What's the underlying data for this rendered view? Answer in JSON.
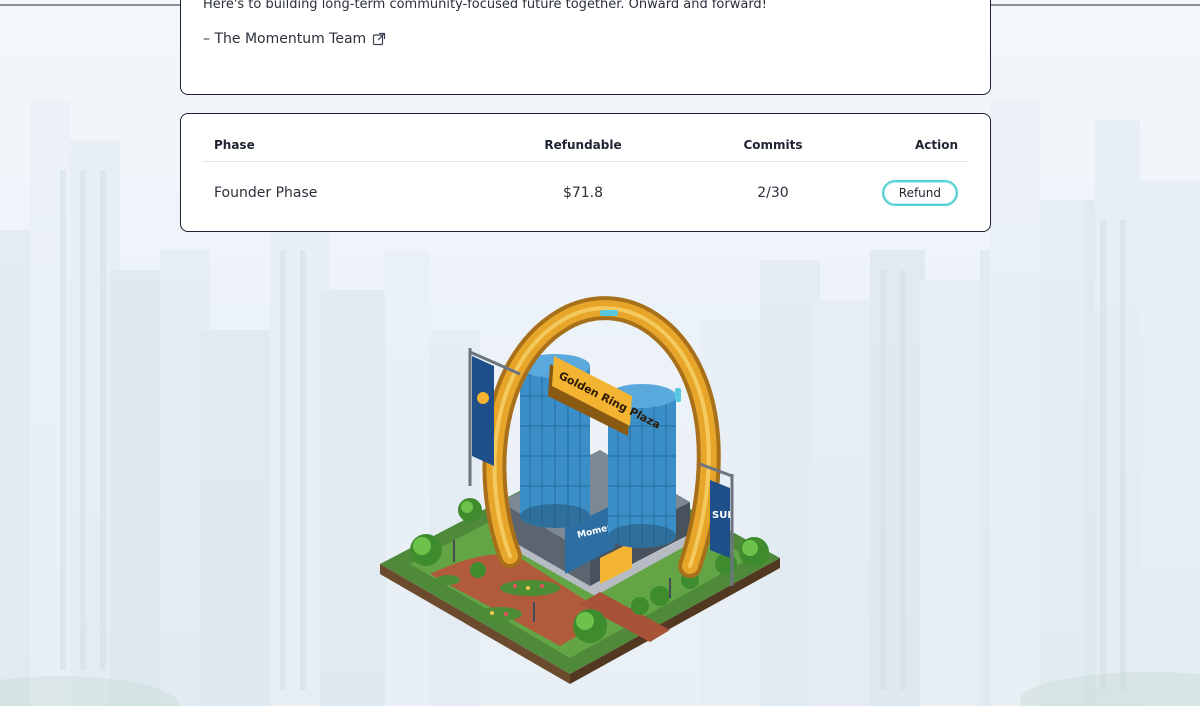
{
  "letter": {
    "closing_line": "Here's to building long-term community-focused future together. Onward and forward!",
    "signature": "– The Momentum Team",
    "signature_icon": "external-link-icon"
  },
  "phases_table": {
    "headers": {
      "phase": "Phase",
      "refundable": "Refundable",
      "commits": "Commits",
      "action": "Action"
    },
    "rows": [
      {
        "phase": "Founder Phase",
        "refundable": "$71.8",
        "commits": "2/30",
        "action_label": "Refund"
      }
    ]
  },
  "illustration": {
    "sign_text": "Golden Ring Plaza",
    "banner_text": "SUI",
    "facade_text": "Momentum"
  },
  "colors": {
    "card_border": "#1d2330",
    "button_accent": "#54d1d6",
    "ring_gold": "#e7a52a",
    "tower_blue": "#3a8fc8"
  }
}
